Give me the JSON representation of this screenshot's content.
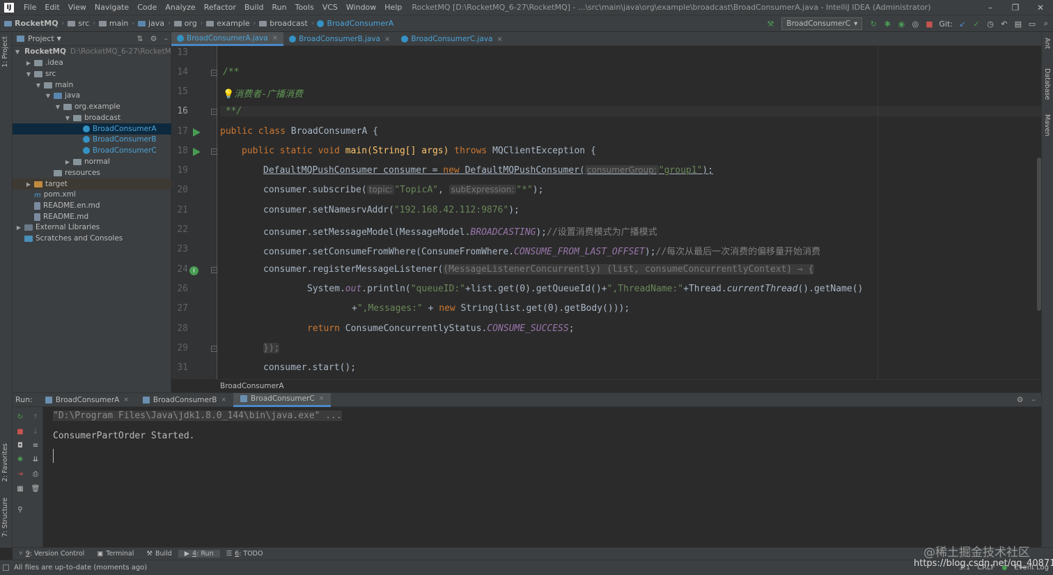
{
  "window": {
    "logo": "IJ",
    "menu": [
      "File",
      "Edit",
      "View",
      "Navigate",
      "Code",
      "Analyze",
      "Refactor",
      "Build",
      "Run",
      "Tools",
      "VCS",
      "Window",
      "Help"
    ],
    "title": "RocketMQ [D:\\RocketMQ_6-27\\RocketMQ] - ...\\src\\main\\java\\org\\example\\broadcast\\BroadConsumerA.java - IntelliJ IDEA (Administrator)",
    "controls": [
      "–",
      "❐",
      "✕"
    ]
  },
  "navbar": {
    "project": "RocketMQ",
    "crumbs": [
      "src",
      "main",
      "java",
      "org",
      "example",
      "broadcast"
    ],
    "current_file": "BroadConsumerA",
    "run_config": "BroadConsumerC",
    "git_label": "Git:"
  },
  "side_tabs": {
    "left": [
      "1: Project",
      "2: Favorites",
      "7: Structure"
    ],
    "right": [
      "Ant",
      "Database",
      "Maven"
    ]
  },
  "project_panel": {
    "title": "Project",
    "tree": [
      {
        "name": "RocketMQ",
        "path": "D:\\RocketMQ_6-27\\RocketMQ",
        "arrow": "▼",
        "icon": "module",
        "indent": 0,
        "bold": true
      },
      {
        "name": ".idea",
        "arrow": "▶",
        "icon": "folder",
        "indent": 1
      },
      {
        "name": "src",
        "arrow": "▼",
        "icon": "folder",
        "indent": 1
      },
      {
        "name": "main",
        "arrow": "▼",
        "icon": "folder",
        "indent": 2
      },
      {
        "name": "java",
        "arrow": "▼",
        "icon": "folder-blue",
        "indent": 3
      },
      {
        "name": "org.example",
        "arrow": "▼",
        "icon": "folder",
        "indent": 4
      },
      {
        "name": "broadcast",
        "arrow": "▼",
        "icon": "folder",
        "indent": 5
      },
      {
        "name": "BroadConsumerA",
        "arrow": "",
        "icon": "class",
        "indent": 6,
        "blue": true,
        "selected": true
      },
      {
        "name": "BroadConsumerB",
        "arrow": "",
        "icon": "class",
        "indent": 6,
        "blue": true
      },
      {
        "name": "BroadConsumerC",
        "arrow": "",
        "icon": "class",
        "indent": 6,
        "blue": true
      },
      {
        "name": "normal",
        "arrow": "▶",
        "icon": "folder",
        "indent": 5
      },
      {
        "name": "resources",
        "arrow": "",
        "icon": "folder",
        "indent": 3
      },
      {
        "name": "target",
        "arrow": "▶",
        "icon": "folder-orange",
        "indent": 1,
        "highlight": true
      },
      {
        "name": "pom.xml",
        "arrow": "",
        "icon": "xml",
        "indent": 1
      },
      {
        "name": "README.en.md",
        "arrow": "",
        "icon": "md",
        "indent": 1
      },
      {
        "name": "README.md",
        "arrow": "",
        "icon": "md",
        "indent": 1
      },
      {
        "name": "External Libraries",
        "arrow": "▶",
        "icon": "libs",
        "indent": 0
      },
      {
        "name": "Scratches and Consoles",
        "arrow": "",
        "icon": "scratch",
        "indent": 0
      }
    ]
  },
  "editor": {
    "tabs": [
      {
        "label": "BroadConsumerA.java",
        "active": true
      },
      {
        "label": "BroadConsumerB.java",
        "active": false
      },
      {
        "label": "BroadConsumerC.java",
        "active": false
      }
    ],
    "line_numbers": [
      "13",
      "14",
      "15",
      "16",
      "17",
      "18",
      "19",
      "20",
      "21",
      "22",
      "23",
      "24",
      "26",
      "27",
      "28",
      "29",
      "31"
    ],
    "current_line": "16",
    "breadcrumb": "BroadConsumerA"
  },
  "code": {
    "l14": "/**",
    "l15": "消费者-广播消费",
    "l16": "**/",
    "l17_kw": "public class ",
    "l17_rest": "BroadConsumerA {",
    "l18_kw1": "public static void ",
    "l18_main": "main(String[] args) ",
    "l18_kw2": "throws ",
    "l18_rest": "MQClientException {",
    "l19_a": "DefaultMQPushConsumer consumer = ",
    "l19_new": "new ",
    "l19_b": "DefaultMQPushConsumer(",
    "l19_hint": "consumerGroup:",
    "l19_str": "\"group1\"",
    "l19_end": ");",
    "l20_a": "consumer.subscribe(",
    "l20_hint1": "topic:",
    "l20_str1": "\"TopicA\"",
    "l20_sep": ", ",
    "l20_hint2": "subExpression:",
    "l20_str2": "\"*\"",
    "l20_end": ");",
    "l21_a": "consumer.setNamesrvAddr(",
    "l21_str": "\"192.168.42.112:9876\"",
    "l21_end": ");",
    "l22_a": "consumer.setMessageModel(MessageModel.",
    "l22_const": "BROADCASTING",
    "l22_end": ");",
    "l22_cm": "//设置消费模式为广播模式",
    "l23_a": "consumer.setConsumeFromWhere(ConsumeFromWhere.",
    "l23_const": "CONSUME_FROM_LAST_OFFSET",
    "l23_end": ");",
    "l23_cm": "//每次从最后一次消费的偏移量开始消费",
    "l24_a": "consumer.registerMessageListener(",
    "l24_lambda": "(MessageListenerConcurrently) (list, consumeConcurrentlyContext) → {",
    "l26_a": "System.",
    "l26_out": "out",
    "l26_b": ".println(",
    "l26_str1": "\"queueID:\"",
    "l26_c": "+list.get(0).getQueueId()+",
    "l26_str2": "\",ThreadName:\"",
    "l26_d": "+Thread.",
    "l26_ct": "currentThread",
    "l26_e": "().getName()",
    "l27_a": "+",
    "l27_str": "\",Messages:\"",
    "l27_b": " + ",
    "l27_new": "new ",
    "l27_c": "String(list.get(0).getBody()));",
    "l28_kw": "return ",
    "l28_a": "ConsumeConcurrentlyStatus.",
    "l28_const": "CONSUME_SUCCESS",
    "l28_end": ";",
    "l29": "});",
    "l31": "consumer.start();"
  },
  "run_panel": {
    "label": "Run:",
    "tabs": [
      {
        "label": "BroadConsumerA",
        "active": false
      },
      {
        "label": "BroadConsumerB",
        "active": false
      },
      {
        "label": "BroadConsumerC",
        "active": true
      }
    ],
    "console": {
      "cmd": "\"D:\\Program Files\\Java\\jdk1.8.0_144\\bin\\java.exe\" ...",
      "output": "ConsumerPartOrder Started."
    }
  },
  "bottom_tabs": [
    {
      "num": "9",
      "label": ": Version Control"
    },
    {
      "num": "",
      "label": "Terminal"
    },
    {
      "num": "",
      "label": "Build"
    },
    {
      "num": "4",
      "label": ": Run"
    },
    {
      "num": "6",
      "label": ": TODO"
    }
  ],
  "status": {
    "message": "All files are up-to-date (moments ago)",
    "position": "3:1",
    "line_sep": "CRLF",
    "event_log": "Event Log"
  },
  "watermark": {
    "line1": "@稀土掘金技术社区",
    "line2": "https://blog.csdn.net/qq_40871"
  },
  "colors": {
    "keyword": "#cc7832",
    "string": "#6a8759",
    "comment": "#629755",
    "static": "#9876aa",
    "selection": "#0d293e",
    "accent": "#4aa3d9"
  }
}
